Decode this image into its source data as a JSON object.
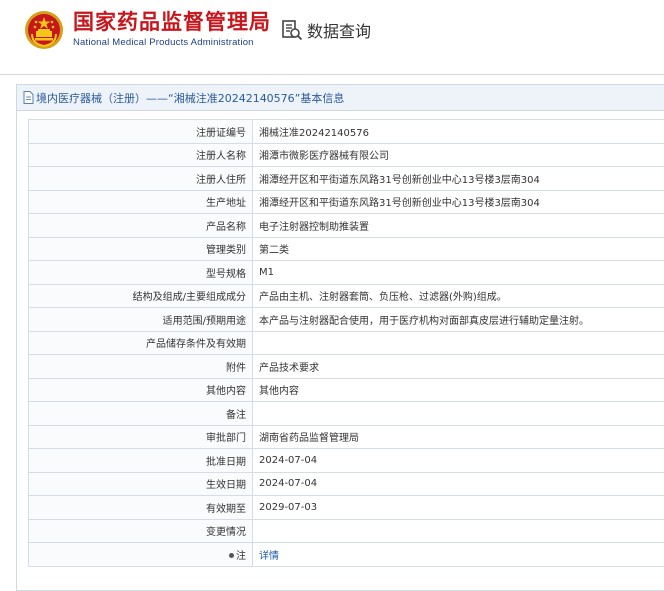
{
  "header": {
    "site_name": "国家药品监督管理局",
    "site_name_en": "National Medical Products Administration",
    "query_label": "数据查询",
    "logo_icon": "national-emblem-icon",
    "query_icon": "document-search-icon"
  },
  "panel": {
    "title": "境内医疗器械（注册）——“湘械注准20242140576”基本信息",
    "title_icon": "document-icon"
  },
  "rows": [
    {
      "label": "注册证编号",
      "value": "湘械注准20242140576"
    },
    {
      "label": "注册人名称",
      "value": "湘潭市微影医疗器械有限公司"
    },
    {
      "label": "注册人住所",
      "value": "湘潭经开区和平街道东风路31号创新创业中心13号楼3层南304"
    },
    {
      "label": "生产地址",
      "value": "湘潭经开区和平街道东风路31号创新创业中心13号楼3层南304"
    },
    {
      "label": "产品名称",
      "value": "电子注射器控制助推装置"
    },
    {
      "label": "管理类别",
      "value": "第二类"
    },
    {
      "label": "型号规格",
      "value": "M1"
    },
    {
      "label": "结构及组成/主要组成成分",
      "value": "产品由主机、注射器套筒、负压枪、过滤器(外购)组成。"
    },
    {
      "label": "适用范围/预期用途",
      "value": "本产品与注射器配合使用，用于医疗机构对面部真皮层进行辅助定量注射。"
    },
    {
      "label": "产品储存条件及有效期",
      "value": ""
    },
    {
      "label": "附件",
      "value": "产品技术要求"
    },
    {
      "label": "其他内容",
      "value": "其他内容"
    },
    {
      "label": "备注",
      "value": ""
    },
    {
      "label": "审批部门",
      "value": "湖南省药品监督管理局"
    },
    {
      "label": "批准日期",
      "value": "2024-07-04"
    },
    {
      "label": "生效日期",
      "value": "2024-07-04"
    },
    {
      "label": "有效期至",
      "value": "2029-07-03"
    },
    {
      "label": "变更情况",
      "value": ""
    }
  ],
  "note_row": {
    "label": "注",
    "link": "详情"
  },
  "colors": {
    "brand_red": "#c8161d",
    "brand_blue": "#1f3f8a",
    "link_blue": "#1a5aa8",
    "title_bg": "#eef3f9"
  }
}
